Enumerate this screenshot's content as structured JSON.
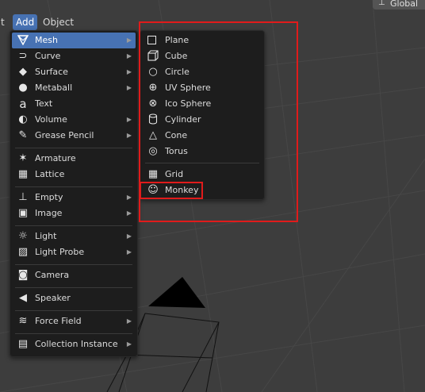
{
  "header": {
    "edge_text": "t",
    "add_label": "Add",
    "object_label": "Object",
    "orientation_label": "Global"
  },
  "colors": {
    "accent": "#4772b3",
    "menu_bg": "#1d1d1d",
    "highlight": "#e01b1b"
  },
  "add_menu": {
    "items": [
      {
        "label": "Mesh",
        "icon": "mesh-icon",
        "submenu": true
      },
      {
        "label": "Curve",
        "icon": "curve-icon",
        "submenu": true
      },
      {
        "label": "Surface",
        "icon": "surface-icon",
        "submenu": true
      },
      {
        "label": "Metaball",
        "icon": "metaball-icon",
        "submenu": true
      },
      {
        "label": "Text",
        "icon": "text-icon",
        "submenu": false
      },
      {
        "label": "Volume",
        "icon": "volume-icon",
        "submenu": true
      },
      {
        "label": "Grease Pencil",
        "icon": "grease-pencil-icon",
        "submenu": true
      },
      {
        "label": "Armature",
        "icon": "armature-icon",
        "submenu": false
      },
      {
        "label": "Lattice",
        "icon": "lattice-icon",
        "submenu": false
      },
      {
        "label": "Empty",
        "icon": "empty-icon",
        "submenu": true
      },
      {
        "label": "Image",
        "icon": "image-icon",
        "submenu": true
      },
      {
        "label": "Light",
        "icon": "light-icon",
        "submenu": true
      },
      {
        "label": "Light Probe",
        "icon": "light-probe-icon",
        "submenu": true
      },
      {
        "label": "Camera",
        "icon": "camera-icon",
        "submenu": false
      },
      {
        "label": "Speaker",
        "icon": "speaker-icon",
        "submenu": false
      },
      {
        "label": "Force Field",
        "icon": "force-field-icon",
        "submenu": true
      },
      {
        "label": "Collection Instance",
        "icon": "collection-instance-icon",
        "submenu": true
      }
    ]
  },
  "mesh_menu": {
    "items": [
      {
        "label": "Plane",
        "icon": "plane-icon"
      },
      {
        "label": "Cube",
        "icon": "cube-icon"
      },
      {
        "label": "Circle",
        "icon": "circle-icon"
      },
      {
        "label": "UV Sphere",
        "icon": "uv-sphere-icon"
      },
      {
        "label": "Ico Sphere",
        "icon": "ico-sphere-icon"
      },
      {
        "label": "Cylinder",
        "icon": "cylinder-icon"
      },
      {
        "label": "Cone",
        "icon": "cone-icon"
      },
      {
        "label": "Torus",
        "icon": "torus-icon"
      },
      {
        "label": "Grid",
        "icon": "grid-icon"
      },
      {
        "label": "Monkey",
        "icon": "monkey-icon"
      }
    ]
  }
}
